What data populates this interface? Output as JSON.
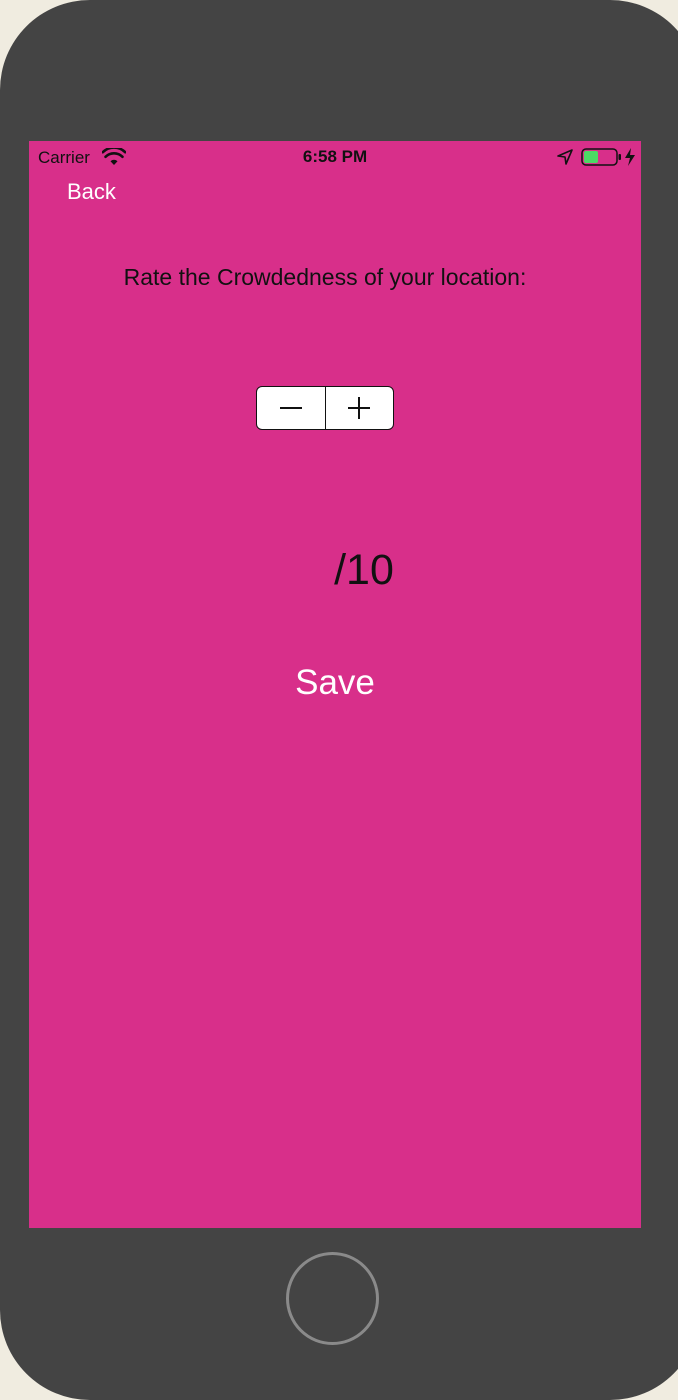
{
  "status_bar": {
    "carrier": "Carrier",
    "time": "6:58 PM",
    "icons": [
      "wifi-icon",
      "location-icon",
      "battery-icon",
      "charging-icon"
    ],
    "battery_level": 0.45,
    "battery_color": "#4cd964"
  },
  "nav": {
    "back_label": "Back"
  },
  "rating": {
    "prompt": "Rate the Crowdedness of your location:",
    "stepper": {
      "decrement_icon": "minus-icon",
      "increment_icon": "plus-icon"
    },
    "value_text": "/10"
  },
  "actions": {
    "save_label": "Save"
  },
  "colors": {
    "screen_background": "#d82f8a",
    "device_frame": "#444444",
    "button_text": "#ffffff"
  }
}
